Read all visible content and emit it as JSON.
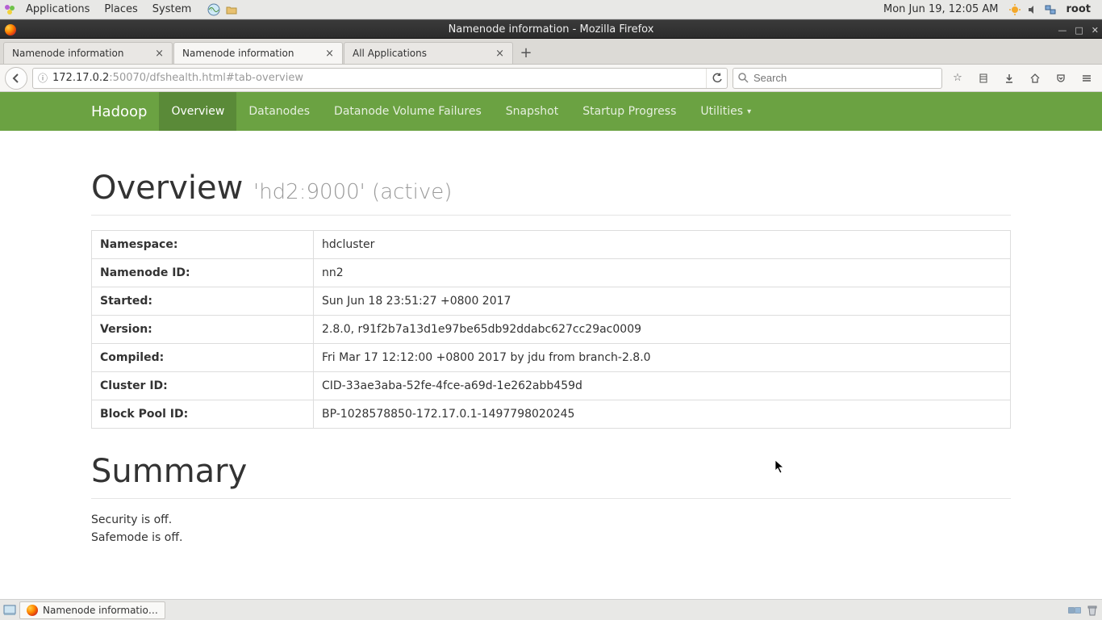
{
  "panel": {
    "applications": "Applications",
    "places": "Places",
    "system": "System",
    "clock": "Mon Jun 19, 12:05 AM",
    "user": "root"
  },
  "window": {
    "title": "Namenode information - Mozilla Firefox"
  },
  "firefox": {
    "tabs": [
      {
        "label": "Namenode information"
      },
      {
        "label": "Namenode information"
      },
      {
        "label": "All Applications"
      }
    ],
    "url_host": "172.17.0.2",
    "url_path": ":50070/dfshealth.html#tab-overview",
    "search_placeholder": "Search"
  },
  "hadoop": {
    "brand": "Hadoop",
    "nav": [
      "Overview",
      "Datanodes",
      "Datanode Volume Failures",
      "Snapshot",
      "Startup Progress",
      "Utilities"
    ],
    "overview_label": "Overview ",
    "overview_small": "'hd2:9000' (active)",
    "rows": [
      {
        "k": "Namespace:",
        "v": "hdcluster"
      },
      {
        "k": "Namenode ID:",
        "v": "nn2"
      },
      {
        "k": "Started:",
        "v": "Sun Jun 18 23:51:27 +0800 2017"
      },
      {
        "k": "Version:",
        "v": "2.8.0, r91f2b7a13d1e97be65db92ddabc627cc29ac0009"
      },
      {
        "k": "Compiled:",
        "v": "Fri Mar 17 12:12:00 +0800 2017 by jdu from branch-2.8.0"
      },
      {
        "k": "Cluster ID:",
        "v": "CID-33ae3aba-52fe-4fce-a69d-1e262abb459d"
      },
      {
        "k": "Block Pool ID:",
        "v": "BP-1028578850-172.17.0.1-1497798020245"
      }
    ],
    "summary_title": "Summary",
    "summary_lines": [
      "Security is off.",
      "Safemode is off."
    ]
  },
  "taskbar": {
    "task": "Namenode informatio…"
  }
}
